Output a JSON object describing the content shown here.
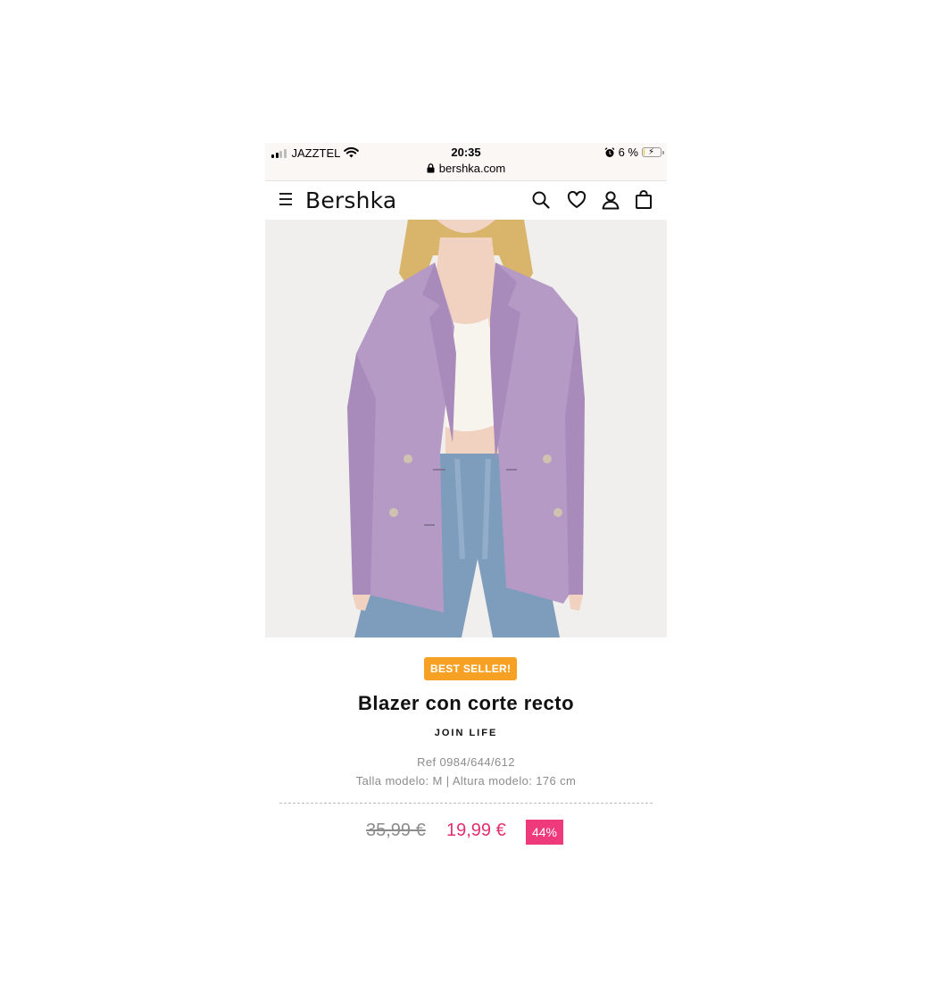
{
  "status_bar": {
    "carrier": "JAZZTEL",
    "time": "20:35",
    "url": "bershka.com",
    "battery": "6 %",
    "battery_level": 0.06
  },
  "nav": {
    "brand": "Bershka",
    "icons": [
      "menu-icon",
      "search-icon",
      "heart-icon",
      "user-icon",
      "bag-icon"
    ]
  },
  "product": {
    "badge": "BEST SELLER!",
    "title": "Blazer con corte recto",
    "subtitle": "JOIN LIFE",
    "ref": "Ref 0984/644/612",
    "model_info": "Talla modelo: M | Altura modelo: 176 cm",
    "price_old": "35,99 €",
    "price_new": "19,99 €",
    "discount": "44%"
  },
  "colors": {
    "badge": "#f6a124",
    "price_new": "#e2306e",
    "discount_bg": "#ee3a7a",
    "blazer": "#b59ac6"
  }
}
